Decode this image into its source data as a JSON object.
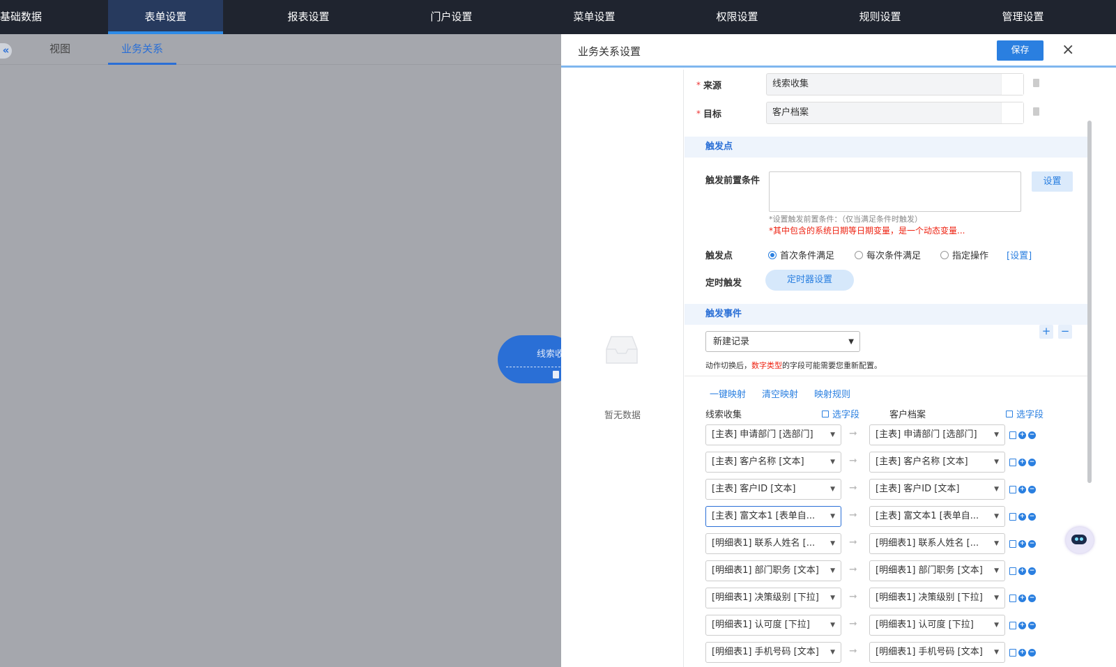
{
  "top_nav": [
    "基础数据",
    "表单设置",
    "报表设置",
    "门户设置",
    "菜单设置",
    "权限设置",
    "规则设置",
    "管理设置"
  ],
  "active_top": "表单设置",
  "sub_tabs": [
    "视图",
    "业务关系"
  ],
  "canvas_node": {
    "label": "线索收"
  },
  "collapse_glyph": "«",
  "panel": {
    "title": "业务关系设置",
    "save": "保存",
    "close": "×",
    "empty": "暂无数据",
    "source_label": "来源",
    "source_value": "线索收集",
    "target_label": "目标",
    "target_value": "客户档案",
    "required_mark": "*",
    "trigger_section": "触发点",
    "precondition_label": "触发前置条件",
    "set_btn": "设置",
    "precondition_hint": "*设置触发前置条件：（仅当满足条件时触发）",
    "precondition_warn": "*其中包含的系统日期等日期变量，是一个动态变量...",
    "trigger_point_label": "触发点",
    "trigger_options": [
      "首次条件满足",
      "每次条件满足",
      "指定操作"
    ],
    "trigger_selected": 0,
    "trigger_link": "[设置]",
    "timer_label": "定时触发",
    "timer_btn": "定时器设置",
    "event_section": "触发事件",
    "add": "+",
    "remove": "−",
    "event_select": "新建记录",
    "event_note_pre": "动作切换后，",
    "event_note_red": "数字类型",
    "event_note_post": "的字段可能需要您重新配置。",
    "mapping_links": [
      "一键映射",
      "清空映射",
      "映射规则"
    ],
    "left_col": "线索收集",
    "right_col": "客户档案",
    "pick_field": "选字段",
    "rows": [
      {
        "left": "[主表] 申请部门 [选部门]",
        "right": "[主表] 申请部门 [选部门]"
      },
      {
        "left": "[主表] 客户名称 [文本]",
        "right": "[主表] 客户名称 [文本]"
      },
      {
        "left": "[主表] 客户ID [文本]",
        "right": "[主表] 客户ID [文本]"
      },
      {
        "left": "[主表] 富文本1 [表单自...",
        "right": "[主表] 富文本1 [表单自..."
      },
      {
        "left": "[明细表1] 联系人姓名 [...",
        "right": "[明细表1] 联系人姓名 [..."
      },
      {
        "left": "[明细表1] 部门职务 [文本]",
        "right": "[明细表1] 部门职务 [文本]"
      },
      {
        "left": "[明细表1] 决策级别 [下拉]",
        "right": "[明细表1] 决策级别 [下拉]"
      },
      {
        "left": "[明细表1] 认可度 [下拉]",
        "right": "[明细表1] 认可度 [下拉]"
      },
      {
        "left": "[明细表1] 手机号码 [文本]",
        "right": "[明细表1] 手机号码 [文本]"
      }
    ]
  },
  "colors": {
    "nav_bg": "#1f242f",
    "accent": "#2a6fd6",
    "overlay": "#a5a7ad"
  }
}
